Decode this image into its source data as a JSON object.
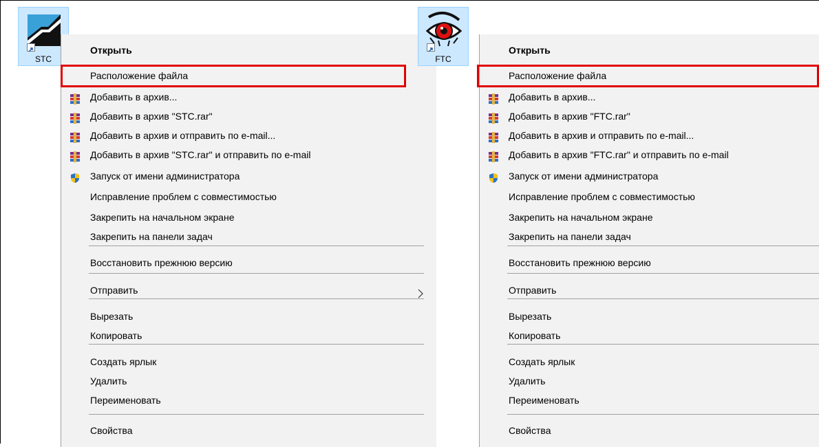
{
  "left": {
    "shortcut_label": "STC",
    "menu": [
      {
        "label": "Открыть",
        "bold": true
      },
      {
        "label": "Расположение файла"
      },
      {
        "label": "Добавить в архив...",
        "icon": "winrar-icon"
      },
      {
        "label": "Добавить в архив \"STC.rar\"",
        "icon": "winrar-icon"
      },
      {
        "label": "Добавить в архив и отправить по e-mail...",
        "icon": "winrar-icon"
      },
      {
        "label": "Добавить в архив \"STC.rar\" и отправить по e-mail",
        "icon": "winrar-icon"
      },
      {
        "label": "Запуск от имени администратора",
        "icon": "uac-shield-icon"
      },
      {
        "label": "Исправление проблем с совместимостью"
      },
      {
        "label": "Закрепить на начальном экране"
      },
      {
        "label": "Закрепить на панели задач"
      },
      {
        "separator": true
      },
      {
        "label": "Восстановить прежнюю версию"
      },
      {
        "separator": true
      },
      {
        "label": "Отправить",
        "submenu": true
      },
      {
        "separator": true
      },
      {
        "label": "Вырезать"
      },
      {
        "label": "Копировать"
      },
      {
        "separator": true
      },
      {
        "label": "Создать ярлык"
      },
      {
        "label": "Удалить"
      },
      {
        "label": "Переименовать"
      },
      {
        "separator": true
      },
      {
        "label": "Свойства"
      }
    ]
  },
  "right": {
    "shortcut_label": "FTC",
    "menu": [
      {
        "label": "Открыть",
        "bold": true
      },
      {
        "label": "Расположение файла"
      },
      {
        "label": "Добавить в архив...",
        "icon": "winrar-icon"
      },
      {
        "label": "Добавить в архив \"FTC.rar\"",
        "icon": "winrar-icon"
      },
      {
        "label": "Добавить в архив и отправить по e-mail...",
        "icon": "winrar-icon"
      },
      {
        "label": "Добавить в архив \"FTC.rar\" и отправить по e-mail",
        "icon": "winrar-icon"
      },
      {
        "label": "Запуск от имени администратора",
        "icon": "uac-shield-icon"
      },
      {
        "label": "Исправление проблем с совместимостью"
      },
      {
        "label": "Закрепить на начальном экране"
      },
      {
        "label": "Закрепить на панели задач"
      },
      {
        "separator": true
      },
      {
        "label": "Восстановить прежнюю версию"
      },
      {
        "separator": true
      },
      {
        "label": "Отправить",
        "submenu": true
      },
      {
        "separator": true
      },
      {
        "label": "Вырезать"
      },
      {
        "label": "Копировать"
      },
      {
        "separator": true
      },
      {
        "label": "Создать ярлык"
      },
      {
        "label": "Удалить"
      },
      {
        "label": "Переименовать"
      },
      {
        "separator": true
      },
      {
        "label": "Свойства"
      }
    ]
  },
  "colors": {
    "menu_bg": "#f2f2f2",
    "selection_bg": "#cce8ff",
    "highlight_border": "#e00000"
  }
}
